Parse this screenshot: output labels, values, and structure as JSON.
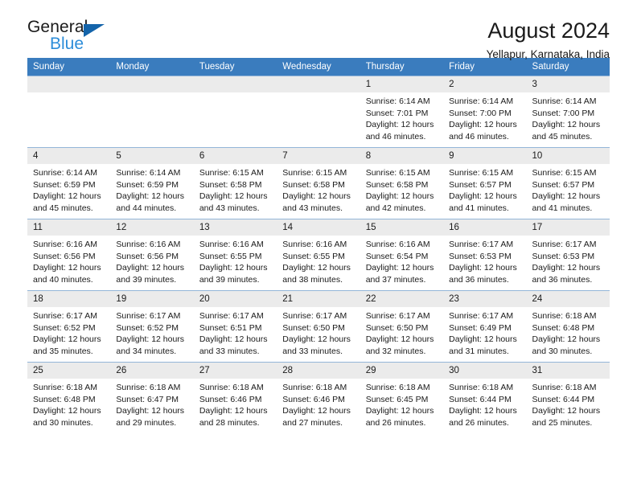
{
  "logo": {
    "word1": "General",
    "word2": "Blue",
    "triangle_color": "#1464aa",
    "blue_color": "#2d8dd9"
  },
  "header": {
    "title": "August 2024",
    "subtitle": "Yellapur, Karnataka, India"
  },
  "theme": {
    "header_row_bg": "#3a7cbe",
    "daynum_bg": "#ebebeb",
    "grid_line": "#93b6d8"
  },
  "weekdays": [
    "Sunday",
    "Monday",
    "Tuesday",
    "Wednesday",
    "Thursday",
    "Friday",
    "Saturday"
  ],
  "weeks": [
    [
      {
        "day": "",
        "empty": true
      },
      {
        "day": "",
        "empty": true
      },
      {
        "day": "",
        "empty": true
      },
      {
        "day": "",
        "empty": true
      },
      {
        "day": "1",
        "sunrise": "Sunrise: 6:14 AM",
        "sunset": "Sunset: 7:01 PM",
        "daylight1": "Daylight: 12 hours",
        "daylight2": "and 46 minutes."
      },
      {
        "day": "2",
        "sunrise": "Sunrise: 6:14 AM",
        "sunset": "Sunset: 7:00 PM",
        "daylight1": "Daylight: 12 hours",
        "daylight2": "and 46 minutes."
      },
      {
        "day": "3",
        "sunrise": "Sunrise: 6:14 AM",
        "sunset": "Sunset: 7:00 PM",
        "daylight1": "Daylight: 12 hours",
        "daylight2": "and 45 minutes."
      }
    ],
    [
      {
        "day": "4",
        "sunrise": "Sunrise: 6:14 AM",
        "sunset": "Sunset: 6:59 PM",
        "daylight1": "Daylight: 12 hours",
        "daylight2": "and 45 minutes."
      },
      {
        "day": "5",
        "sunrise": "Sunrise: 6:14 AM",
        "sunset": "Sunset: 6:59 PM",
        "daylight1": "Daylight: 12 hours",
        "daylight2": "and 44 minutes."
      },
      {
        "day": "6",
        "sunrise": "Sunrise: 6:15 AM",
        "sunset": "Sunset: 6:58 PM",
        "daylight1": "Daylight: 12 hours",
        "daylight2": "and 43 minutes."
      },
      {
        "day": "7",
        "sunrise": "Sunrise: 6:15 AM",
        "sunset": "Sunset: 6:58 PM",
        "daylight1": "Daylight: 12 hours",
        "daylight2": "and 43 minutes."
      },
      {
        "day": "8",
        "sunrise": "Sunrise: 6:15 AM",
        "sunset": "Sunset: 6:58 PM",
        "daylight1": "Daylight: 12 hours",
        "daylight2": "and 42 minutes."
      },
      {
        "day": "9",
        "sunrise": "Sunrise: 6:15 AM",
        "sunset": "Sunset: 6:57 PM",
        "daylight1": "Daylight: 12 hours",
        "daylight2": "and 41 minutes."
      },
      {
        "day": "10",
        "sunrise": "Sunrise: 6:15 AM",
        "sunset": "Sunset: 6:57 PM",
        "daylight1": "Daylight: 12 hours",
        "daylight2": "and 41 minutes."
      }
    ],
    [
      {
        "day": "11",
        "sunrise": "Sunrise: 6:16 AM",
        "sunset": "Sunset: 6:56 PM",
        "daylight1": "Daylight: 12 hours",
        "daylight2": "and 40 minutes."
      },
      {
        "day": "12",
        "sunrise": "Sunrise: 6:16 AM",
        "sunset": "Sunset: 6:56 PM",
        "daylight1": "Daylight: 12 hours",
        "daylight2": "and 39 minutes."
      },
      {
        "day": "13",
        "sunrise": "Sunrise: 6:16 AM",
        "sunset": "Sunset: 6:55 PM",
        "daylight1": "Daylight: 12 hours",
        "daylight2": "and 39 minutes."
      },
      {
        "day": "14",
        "sunrise": "Sunrise: 6:16 AM",
        "sunset": "Sunset: 6:55 PM",
        "daylight1": "Daylight: 12 hours",
        "daylight2": "and 38 minutes."
      },
      {
        "day": "15",
        "sunrise": "Sunrise: 6:16 AM",
        "sunset": "Sunset: 6:54 PM",
        "daylight1": "Daylight: 12 hours",
        "daylight2": "and 37 minutes."
      },
      {
        "day": "16",
        "sunrise": "Sunrise: 6:17 AM",
        "sunset": "Sunset: 6:53 PM",
        "daylight1": "Daylight: 12 hours",
        "daylight2": "and 36 minutes."
      },
      {
        "day": "17",
        "sunrise": "Sunrise: 6:17 AM",
        "sunset": "Sunset: 6:53 PM",
        "daylight1": "Daylight: 12 hours",
        "daylight2": "and 36 minutes."
      }
    ],
    [
      {
        "day": "18",
        "sunrise": "Sunrise: 6:17 AM",
        "sunset": "Sunset: 6:52 PM",
        "daylight1": "Daylight: 12 hours",
        "daylight2": "and 35 minutes."
      },
      {
        "day": "19",
        "sunrise": "Sunrise: 6:17 AM",
        "sunset": "Sunset: 6:52 PM",
        "daylight1": "Daylight: 12 hours",
        "daylight2": "and 34 minutes."
      },
      {
        "day": "20",
        "sunrise": "Sunrise: 6:17 AM",
        "sunset": "Sunset: 6:51 PM",
        "daylight1": "Daylight: 12 hours",
        "daylight2": "and 33 minutes."
      },
      {
        "day": "21",
        "sunrise": "Sunrise: 6:17 AM",
        "sunset": "Sunset: 6:50 PM",
        "daylight1": "Daylight: 12 hours",
        "daylight2": "and 33 minutes."
      },
      {
        "day": "22",
        "sunrise": "Sunrise: 6:17 AM",
        "sunset": "Sunset: 6:50 PM",
        "daylight1": "Daylight: 12 hours",
        "daylight2": "and 32 minutes."
      },
      {
        "day": "23",
        "sunrise": "Sunrise: 6:17 AM",
        "sunset": "Sunset: 6:49 PM",
        "daylight1": "Daylight: 12 hours",
        "daylight2": "and 31 minutes."
      },
      {
        "day": "24",
        "sunrise": "Sunrise: 6:18 AM",
        "sunset": "Sunset: 6:48 PM",
        "daylight1": "Daylight: 12 hours",
        "daylight2": "and 30 minutes."
      }
    ],
    [
      {
        "day": "25",
        "sunrise": "Sunrise: 6:18 AM",
        "sunset": "Sunset: 6:48 PM",
        "daylight1": "Daylight: 12 hours",
        "daylight2": "and 30 minutes."
      },
      {
        "day": "26",
        "sunrise": "Sunrise: 6:18 AM",
        "sunset": "Sunset: 6:47 PM",
        "daylight1": "Daylight: 12 hours",
        "daylight2": "and 29 minutes."
      },
      {
        "day": "27",
        "sunrise": "Sunrise: 6:18 AM",
        "sunset": "Sunset: 6:46 PM",
        "daylight1": "Daylight: 12 hours",
        "daylight2": "and 28 minutes."
      },
      {
        "day": "28",
        "sunrise": "Sunrise: 6:18 AM",
        "sunset": "Sunset: 6:46 PM",
        "daylight1": "Daylight: 12 hours",
        "daylight2": "and 27 minutes."
      },
      {
        "day": "29",
        "sunrise": "Sunrise: 6:18 AM",
        "sunset": "Sunset: 6:45 PM",
        "daylight1": "Daylight: 12 hours",
        "daylight2": "and 26 minutes."
      },
      {
        "day": "30",
        "sunrise": "Sunrise: 6:18 AM",
        "sunset": "Sunset: 6:44 PM",
        "daylight1": "Daylight: 12 hours",
        "daylight2": "and 26 minutes."
      },
      {
        "day": "31",
        "sunrise": "Sunrise: 6:18 AM",
        "sunset": "Sunset: 6:44 PM",
        "daylight1": "Daylight: 12 hours",
        "daylight2": "and 25 minutes."
      }
    ]
  ]
}
